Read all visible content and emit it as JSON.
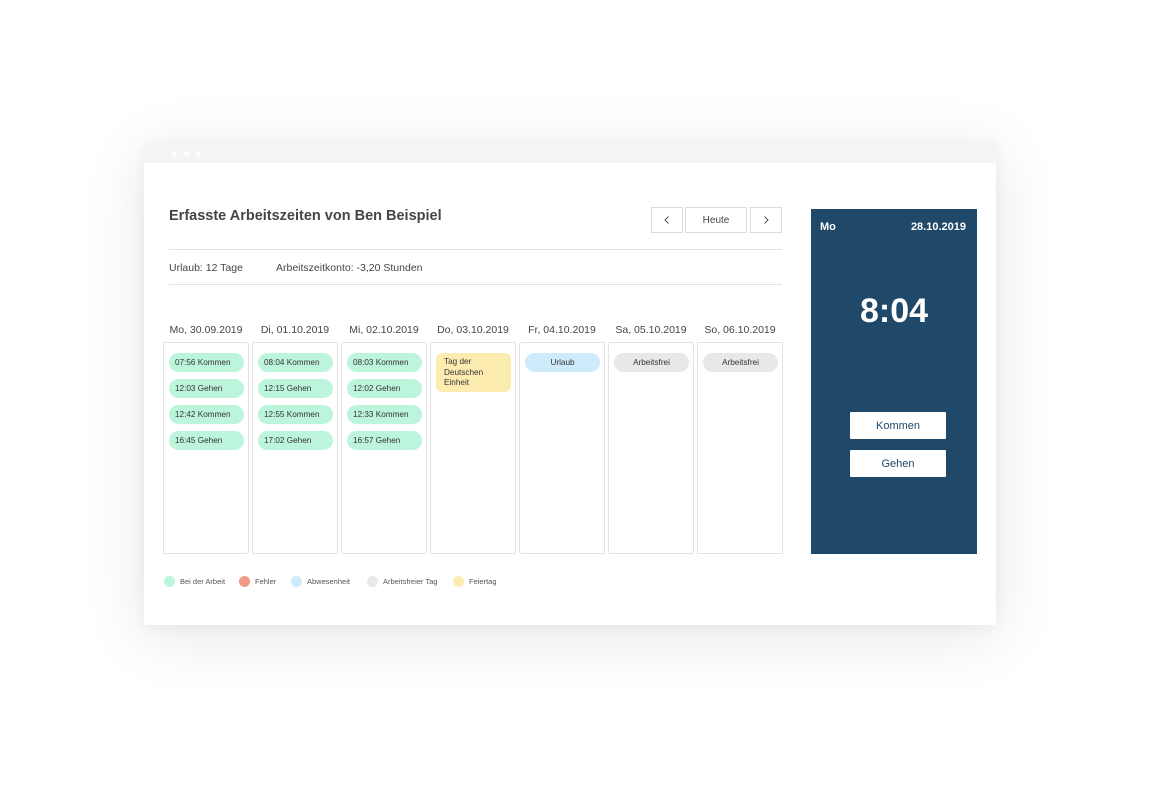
{
  "header": {
    "title": "Erfasste Arbeitszeiten von Ben Beispiel",
    "prev_icon": "chevron-left-icon",
    "today_label": "Heute",
    "next_icon": "chevron-right-icon"
  },
  "summary": {
    "vacation": "Urlaub: 12 Tage",
    "account": "Arbeitszeitkonto: -3,20 Stunden"
  },
  "days": [
    {
      "label": "Mo, 30.09.2019",
      "entries": [
        {
          "text": "07:56 Kommen",
          "type": "work"
        },
        {
          "text": "12:03 Gehen",
          "type": "work"
        },
        {
          "text": "12:42 Kommen",
          "type": "work"
        },
        {
          "text": "16:45 Gehen",
          "type": "work"
        }
      ]
    },
    {
      "label": "Di, 01.10.2019",
      "entries": [
        {
          "text": "08:04 Kommen",
          "type": "work"
        },
        {
          "text": "12:15 Gehen",
          "type": "work"
        },
        {
          "text": "12:55 Kommen",
          "type": "work"
        },
        {
          "text": "17:02 Gehen",
          "type": "work"
        }
      ]
    },
    {
      "label": "Mi, 02.10.2019",
      "entries": [
        {
          "text": "08:03 Kommen",
          "type": "work"
        },
        {
          "text": "12:02 Gehen",
          "type": "work"
        },
        {
          "text": "12:33 Kommen",
          "type": "work"
        },
        {
          "text": "16:57 Gehen",
          "type": "work"
        }
      ]
    },
    {
      "label": "Do, 03.10.2019",
      "entries": [
        {
          "text": "Tag der Deutschen Einheit",
          "type": "holiday"
        }
      ]
    },
    {
      "label": "Fr, 04.10.2019",
      "entries": [
        {
          "text": "Urlaub",
          "type": "abs"
        }
      ]
    },
    {
      "label": "Sa, 05.10.2019",
      "entries": [
        {
          "text": "Arbeitsfrei",
          "type": "free"
        }
      ]
    },
    {
      "label": "So, 06.10.2019",
      "entries": [
        {
          "text": "Arbeitsfrei",
          "type": "free"
        }
      ]
    }
  ],
  "legend": [
    {
      "label": "Bei der Arbeit",
      "color": "#bdf5dc"
    },
    {
      "label": "Fehler",
      "color": "#ef9a84"
    },
    {
      "label": "Abwesenheit",
      "color": "#cdebfb"
    },
    {
      "label": "Arbeitsfreier Tag",
      "color": "#e8e8e8"
    },
    {
      "label": "Feiertag",
      "color": "#fdecb0"
    }
  ],
  "clock_panel": {
    "day": "Mo",
    "date": "28.10.2019",
    "time": "8:04",
    "come_label": "Kommen",
    "go_label": "Gehen"
  },
  "colors": {
    "panel": "#204868",
    "work": "#bdf5dc",
    "absence": "#cdebfb",
    "free": "#e8e8e8",
    "holiday": "#fdecb0",
    "error": "#ef9a84"
  }
}
